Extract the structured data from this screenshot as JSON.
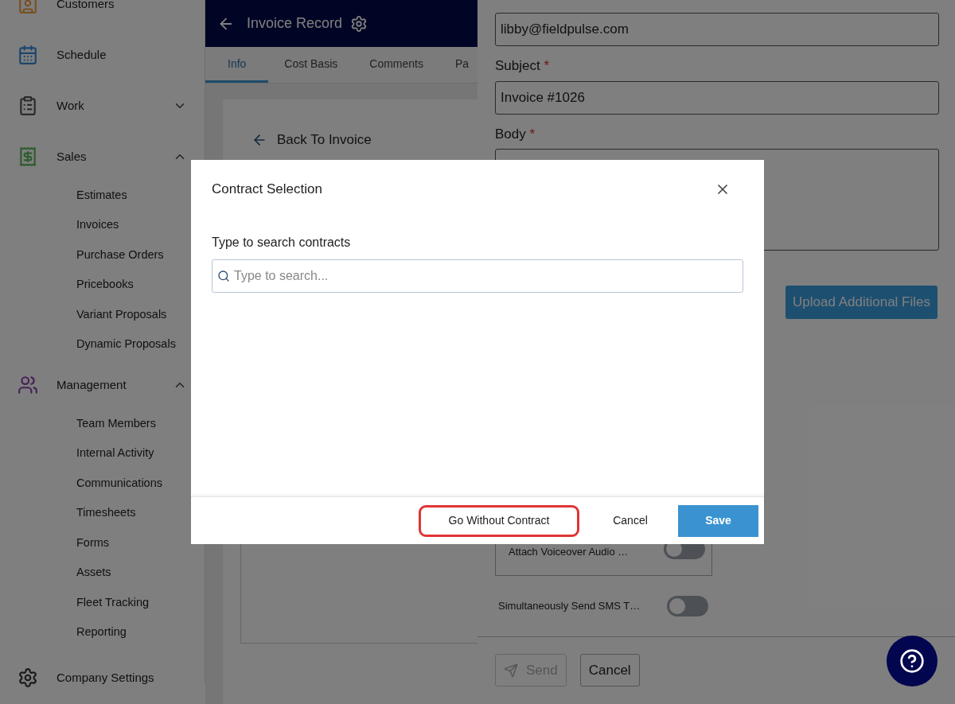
{
  "sidebar": {
    "items": [
      {
        "label": "Customers",
        "kind": "link"
      },
      {
        "label": "Schedule",
        "kind": "link"
      },
      {
        "label": "Work",
        "kind": "group",
        "expanded": false
      },
      {
        "label": "Sales",
        "kind": "group",
        "expanded": true,
        "children": [
          "Estimates",
          "Invoices",
          "Purchase Orders",
          "Pricebooks",
          "Variant Proposals",
          "Dynamic Proposals"
        ]
      },
      {
        "label": "Management",
        "kind": "group",
        "expanded": true,
        "children": [
          "Team Members",
          "Internal Activity",
          "Communications",
          "Timesheets",
          "Forms",
          "Assets",
          "Fleet Tracking",
          "Reporting"
        ]
      },
      {
        "label": "Company Settings",
        "kind": "link"
      }
    ]
  },
  "header": {
    "title": "Invoice Record"
  },
  "tabs": [
    {
      "label": "Info",
      "selected": true
    },
    {
      "label": "Cost Basis",
      "selected": false
    },
    {
      "label": "Comments",
      "selected": false
    },
    {
      "label": "Pa",
      "selected": false
    }
  ],
  "invoice_view": {
    "back_link": "Back To Invoice"
  },
  "email_panel": {
    "to": "libby@fieldpulse.com",
    "subject": {
      "label": "Subject",
      "mark": "*",
      "value": "Invoice #1026"
    },
    "body": {
      "label": "Body",
      "mark": "*"
    },
    "upload_button": "Upload Additional Files",
    "toggles": [
      {
        "label": "Attach Voiceover Audio …",
        "kind": "boxed",
        "on": false
      },
      {
        "label": "Simultaneously Send SMS T…",
        "kind": "plain",
        "on": false
      }
    ],
    "buttons": [
      {
        "label": "Send",
        "kind": "send",
        "disabled": true
      },
      {
        "label": "Cancel",
        "kind": "plain",
        "disabled": false
      }
    ]
  },
  "modal": {
    "title": "Contract Selection",
    "search_label": "Type to search contracts",
    "search_placeholder": "Type to search...",
    "buttons": [
      {
        "label": "Go Without Contract",
        "kind": "highlighted"
      },
      {
        "label": "Cancel",
        "kind": "plain"
      },
      {
        "label": "Save",
        "kind": "primary"
      }
    ]
  }
}
